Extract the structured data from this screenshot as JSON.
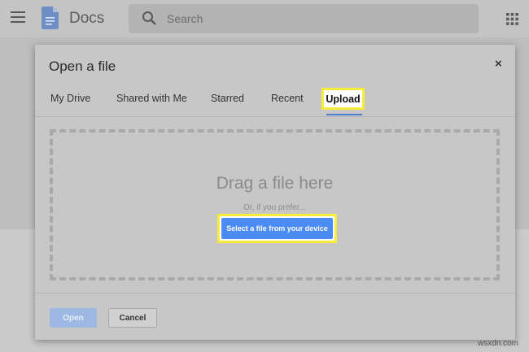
{
  "app": {
    "title": "Docs",
    "search_placeholder": "Search",
    "icons": {
      "menu": "hamburger-icon",
      "logo": "docs-logo",
      "search": "search-icon",
      "apps": "apps-grid-icon"
    }
  },
  "dialog": {
    "title": "Open a file",
    "close_label": "×",
    "tabs": [
      {
        "label": "My Drive"
      },
      {
        "label": "Shared with Me"
      },
      {
        "label": "Starred"
      },
      {
        "label": "Recent"
      },
      {
        "label": "Upload",
        "selected": true
      }
    ],
    "dropzone": {
      "title": "Drag a file here",
      "subtitle": "Or, if you prefer...",
      "select_button": "Select a file from your device"
    },
    "footer": {
      "open_label": "Open",
      "cancel_label": "Cancel"
    }
  },
  "colors": {
    "highlight": "#f8ec3a",
    "primary": "#4b8bf4",
    "tab_underline": "#4a7fd4"
  },
  "watermark": "wsxdn.com"
}
